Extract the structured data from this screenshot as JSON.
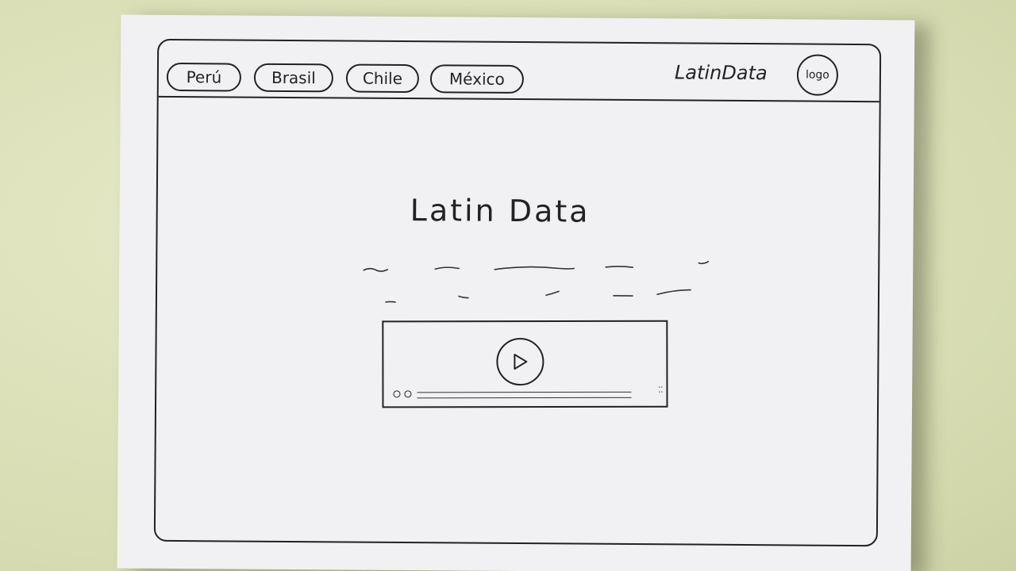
{
  "nav": {
    "tabs": [
      {
        "label": "Perú"
      },
      {
        "label": "Brasil"
      },
      {
        "label": "Chile"
      },
      {
        "label": "México"
      }
    ],
    "brand": "LatinData",
    "logo": "logo"
  },
  "main": {
    "heading": "Latin Data"
  },
  "video": {
    "play_icon": "play-icon",
    "fullscreen_icon": "fullscreen-icon"
  },
  "colors": {
    "paper": "#f1f1f4",
    "ink": "#222222",
    "background": "#dfe4bf"
  }
}
